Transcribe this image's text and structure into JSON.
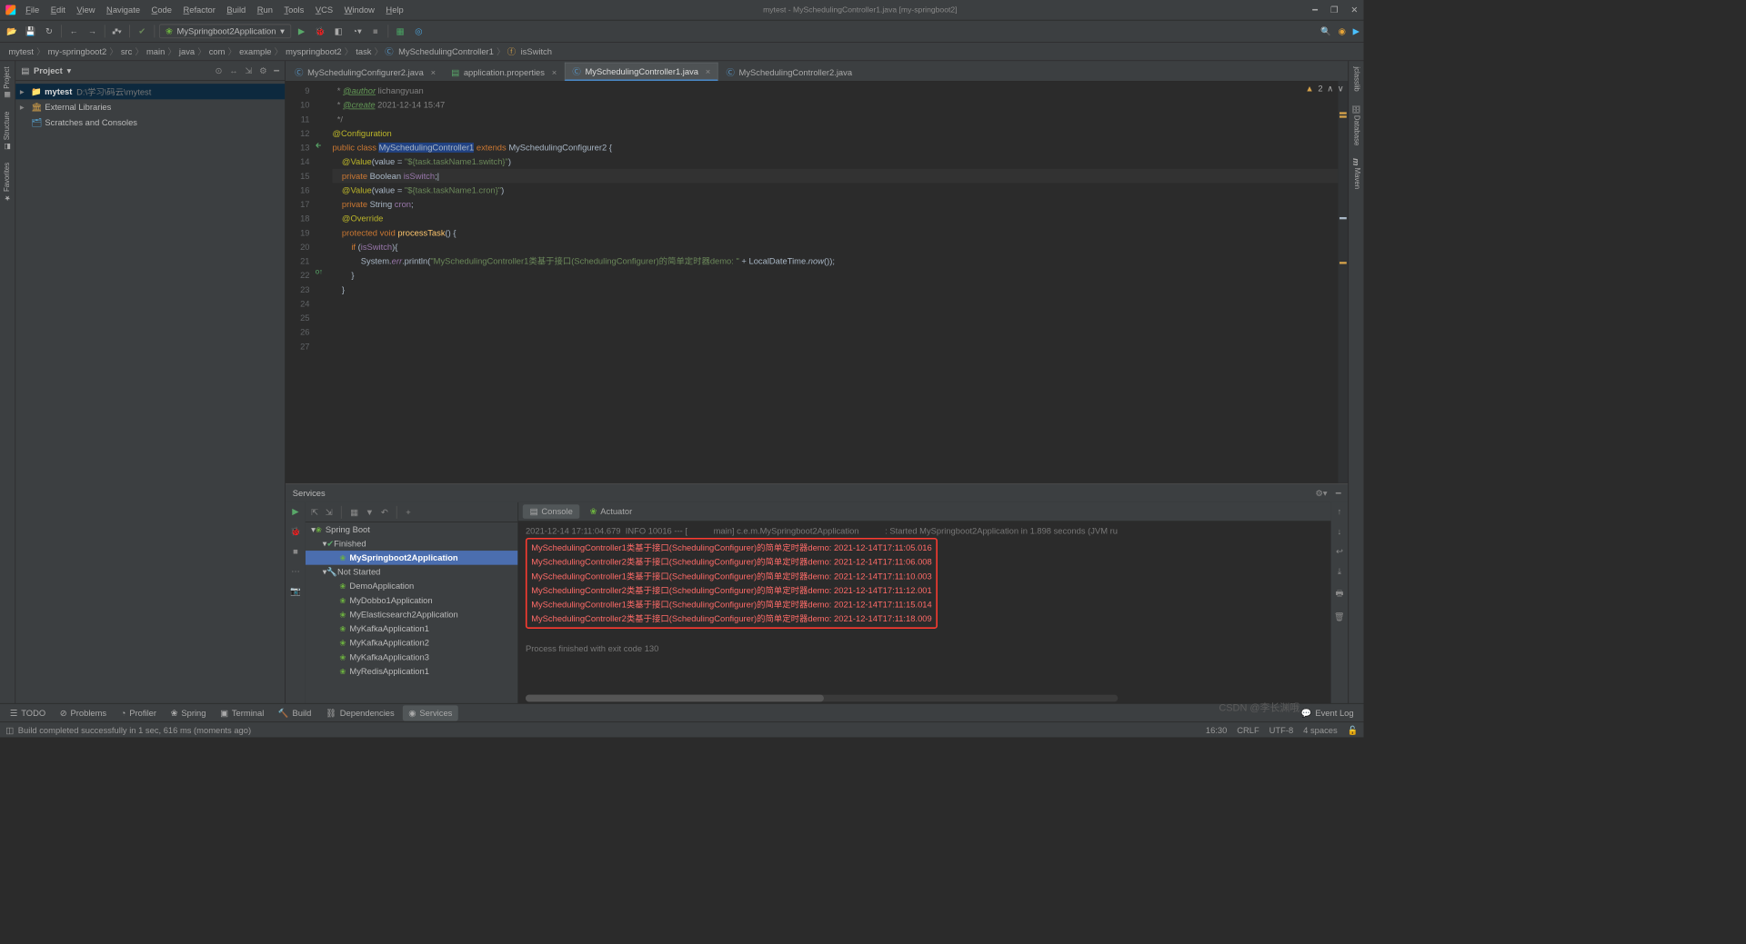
{
  "titlebar": {
    "menus": [
      "File",
      "Edit",
      "View",
      "Navigate",
      "Code",
      "Refactor",
      "Build",
      "Run",
      "Tools",
      "VCS",
      "Window",
      "Help"
    ],
    "title": "mytest - MySchedulingController1.java [my-springboot2]"
  },
  "toolbar": {
    "run_config": "MySpringboot2Application"
  },
  "breadcrumbs": {
    "base": [
      "mytest",
      "my-springboot2",
      "src",
      "main",
      "java",
      "com",
      "example",
      "myspringboot2",
      "task"
    ],
    "class": "MySchedulingController1",
    "field": "isSwitch"
  },
  "project": {
    "title": "Project",
    "root": "mytest",
    "root_path": "D:\\学习\\码云\\mytest",
    "extlib": "External Libraries",
    "scratches": "Scratches and Consoles"
  },
  "tabs": [
    {
      "icon": "class",
      "label": "MySchedulingConfigurer2.java",
      "active": false,
      "x": true
    },
    {
      "icon": "props",
      "label": "application.properties",
      "active": false,
      "x": true
    },
    {
      "icon": "class",
      "label": "MySchedulingController1.java",
      "active": true,
      "x": true
    },
    {
      "icon": "class",
      "label": "MySchedulingController2.java",
      "active": false,
      "x": false
    }
  ],
  "editor": {
    "warnings": "2",
    "first_line_no": 9,
    "lines": [
      {
        "n": 9,
        "html": "  <span class='cmt'>* </span><span class='cmt-tag'>@author</span><span class='cmt'> lichangyuan</span>"
      },
      {
        "n": 10,
        "html": "  <span class='cmt'>* </span><span class='cmt-tag'>@create</span><span class='cmt'> 2021-12-14 15:47</span>"
      },
      {
        "n": 11,
        "html": "  <span class='cmt'>*/</span>"
      },
      {
        "n": 12,
        "html": "<span class='anno'>@Configuration</span>"
      },
      {
        "n": 13,
        "html": "<span class='kw'>public class </span><span class='hl-cls'>MySchedulingController1</span><span class='kw'> extends </span><span class='type'>MySchedulingConfigurer2</span> {",
        "gutter": "🡰"
      },
      {
        "n": 14,
        "html": ""
      },
      {
        "n": 15,
        "html": "    <span class='anno'>@Value</span>(value = <span class='str'>\"${task.taskName1.switch}\"</span>)"
      },
      {
        "n": 16,
        "html": "    <span class='kw'>private</span> <span class='type'>Boolean</span> <span class='field'>isSwitch</span>;<span class='caret'>|</span>",
        "caret": true
      },
      {
        "n": 17,
        "html": ""
      },
      {
        "n": 18,
        "html": "    <span class='anno'>@Value</span>(value = <span class='str'>\"${task.taskName1.cron}\"</span>)"
      },
      {
        "n": 19,
        "html": "    <span class='kw'>private</span> <span class='type'>String</span> <span class='field'>cron</span>;"
      },
      {
        "n": 20,
        "html": ""
      },
      {
        "n": 21,
        "html": "    <span class='anno'>@Override</span>"
      },
      {
        "n": 22,
        "html": "    <span class='kw'>protected void</span> <span class='method'>processTask</span>() {",
        "gutter": "o↑"
      },
      {
        "n": 23,
        "html": "        <span class='kw'>if</span> (<span class='field'>isSwitch</span>){"
      },
      {
        "n": 24,
        "html": "            System.<span class='field static-it'>err</span>.println(<span class='str'>\"MySchedulingController1类基于接口(SchedulingConfigurer)的简单定时器demo: \"</span> + LocalDateTime.<span class='static-it'>now</span>());"
      },
      {
        "n": 25,
        "html": "        }"
      },
      {
        "n": 26,
        "html": ""
      },
      {
        "n": 27,
        "html": "    }"
      }
    ]
  },
  "services": {
    "title": "Services",
    "tree": {
      "root": "Spring Boot",
      "finished": "Finished",
      "selected": "MySpringboot2Application",
      "notstarted": "Not Started",
      "items": [
        "DemoApplication",
        "MyDobbo1Application",
        "MyElasticsearch2Application",
        "MyKafkaApplication1",
        "MyKafkaApplication2",
        "MyKafkaApplication3",
        "MyRedisApplication1"
      ]
    },
    "console_tabs": {
      "console": "Console",
      "actuator": "Actuator"
    },
    "log_header": "2021-12-14 17:11:04.679  INFO 10016 --- [           main] c.e.m.MySpringboot2Application           : Started MySpringboot2Application in 1.898 seconds (JVM ru",
    "logs": [
      "MySchedulingController1类基于接口(SchedulingConfigurer)的简单定时器demo: 2021-12-14T17:11:05.016",
      "MySchedulingController2类基于接口(SchedulingConfigurer)的简单定时器demo: 2021-12-14T17:11:06.008",
      "MySchedulingController1类基于接口(SchedulingConfigurer)的简单定时器demo: 2021-12-14T17:11:10.003",
      "MySchedulingController2类基于接口(SchedulingConfigurer)的简单定时器demo: 2021-12-14T17:11:12.001",
      "MySchedulingController1类基于接口(SchedulingConfigurer)的简单定时器demo: 2021-12-14T17:11:15.014",
      "MySchedulingController2类基于接口(SchedulingConfigurer)的简单定时器demo: 2021-12-14T17:11:18.009"
    ],
    "exit": "Process finished with exit code 130"
  },
  "bottom_tools": [
    "TODO",
    "Problems",
    "Profiler",
    "Spring",
    "Terminal",
    "Build",
    "Dependencies",
    "Services"
  ],
  "bottom_active": "Services",
  "event_log": "Event Log",
  "status": {
    "msg": "Build completed successfully in 1 sec, 616 ms (moments ago)",
    "pos": "16:30",
    "sep": "CRLF",
    "enc": "UTF-8",
    "indent": "4 spaces"
  },
  "watermark": "CSDN @李长渊哦"
}
